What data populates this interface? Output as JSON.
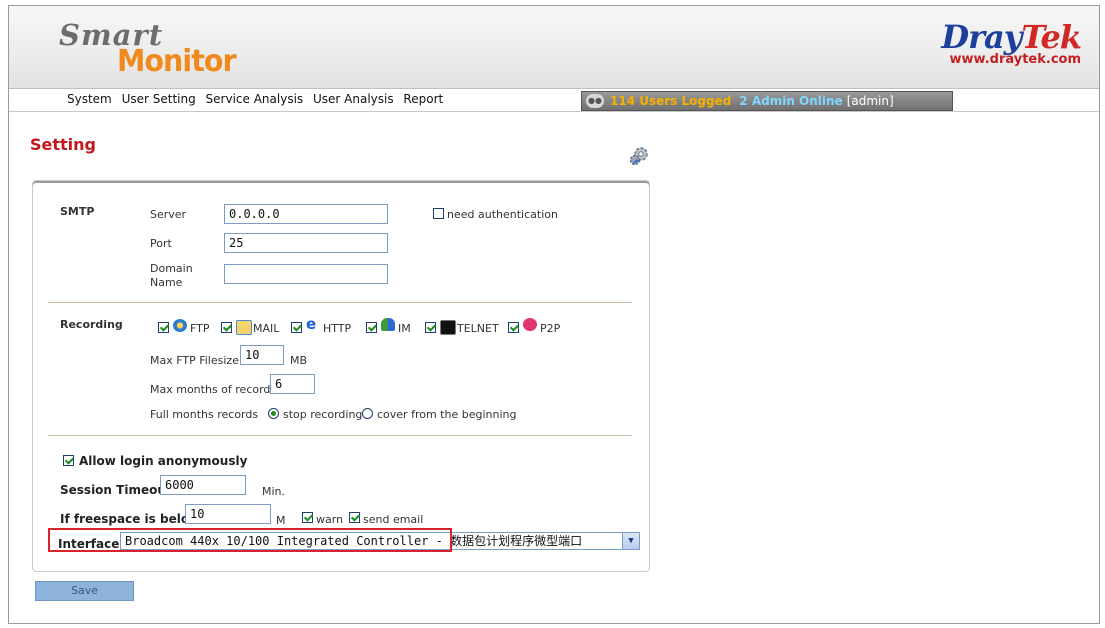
{
  "header": {
    "logo_top": "Smart",
    "logo_bottom": "Monitor",
    "brand_left": "Dray",
    "brand_right": "Tek",
    "brand_url": "www.draytek.com"
  },
  "menu": [
    "System",
    "User Setting",
    "Service Analysis",
    "User Analysis",
    "Report"
  ],
  "status": {
    "users_logged": "114 Users Logged",
    "admins_online": "2 Admin Online",
    "current_user": "[admin]"
  },
  "page": {
    "title": "Setting"
  },
  "smtp": {
    "section": "SMTP",
    "server_label": "Server",
    "server_value": "0.0.0.0",
    "port_label": "Port",
    "port_value": "25",
    "domain_label_1": "Domain",
    "domain_label_2": "Name",
    "domain_value": "",
    "need_auth_label": "need authentication",
    "need_auth_checked": false
  },
  "recording": {
    "section": "Recording",
    "protocols": [
      {
        "label": "FTP",
        "icon": "ftp-icon",
        "checked": true
      },
      {
        "label": "MAIL",
        "icon": "mail-icon",
        "checked": true
      },
      {
        "label": "HTTP",
        "icon": "http-icon",
        "checked": true
      },
      {
        "label": "IM",
        "icon": "im-icon",
        "checked": true
      },
      {
        "label": "TELNET",
        "icon": "telnet-icon",
        "checked": true
      },
      {
        "label": "P2P",
        "icon": "p2p-icon",
        "checked": true
      }
    ],
    "max_ftp_label": "Max FTP Filesize",
    "max_ftp_value": "10",
    "max_ftp_unit": "MB",
    "max_months_label": "Max months of records",
    "max_months_value": "6",
    "full_months_label": "Full months records",
    "option_stop": "stop recording",
    "option_cover": "cover from the beginning",
    "selected_option": "stop recording"
  },
  "general": {
    "allow_anon_label": "Allow login anonymously",
    "allow_anon_checked": true,
    "session_timeout_label": "Session Timeout",
    "session_timeout_value": "6000",
    "session_timeout_unit": "Min.",
    "freespace_label": "If freespace is below",
    "freespace_value": "10",
    "freespace_unit": "M",
    "warn_label": "warn",
    "warn_checked": true,
    "send_email_label": "send email",
    "send_email_checked": true,
    "interface_label": "Interface",
    "interface_value": "Broadcom 440x 10/100 Integrated Controller - 数据包计划程序微型端口"
  },
  "actions": {
    "save_label": "Save"
  },
  "colors": {
    "title_red": "#c4161c",
    "logo_orange": "#f08a1c",
    "brand_blue": "#1b3f9a",
    "brand_red": "#d22727",
    "status_yellow": "#f7b000",
    "status_blue": "#7fd7ff",
    "highlight_red": "#d8232a",
    "save_blue": "#8fb4dc"
  }
}
